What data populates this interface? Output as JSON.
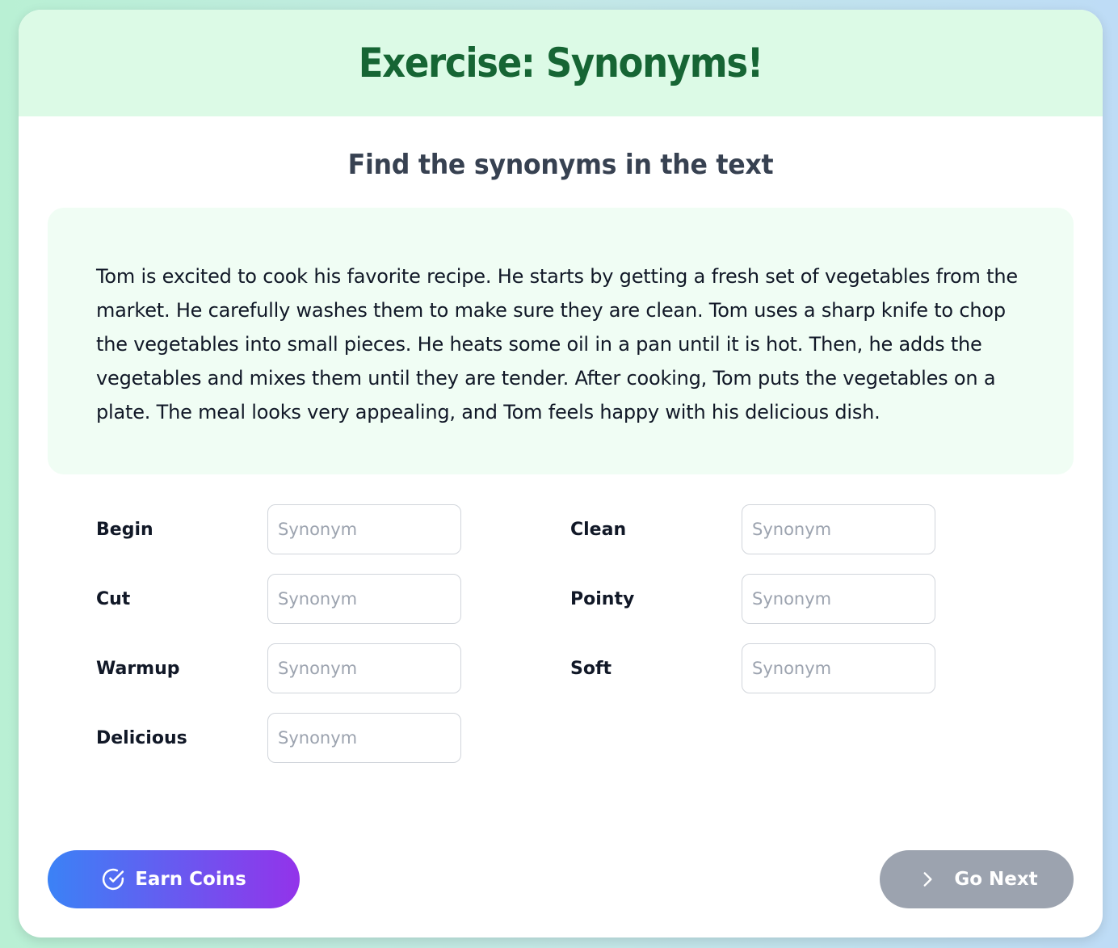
{
  "header": {
    "title": "Exercise: Synonyms!"
  },
  "instructions": "Find the synonyms in the text",
  "passage": "Tom is excited to cook his favorite recipe. He starts by getting a fresh set of vegetables from the market. He carefully washes them to make sure they are clean. Tom uses a sharp knife to chop the vegetables into small pieces. He heats some oil in a pan until it is hot. Then, he adds the vegetables and mixes them until they are tender. After cooking, Tom puts the vegetables on a plate. The meal looks very appealing, and Tom feels happy with his delicious dish.",
  "fields": [
    {
      "label": "Begin",
      "value": "",
      "placeholder": "Synonym"
    },
    {
      "label": "Clean",
      "value": "",
      "placeholder": "Synonym"
    },
    {
      "label": "Cut",
      "value": "",
      "placeholder": "Synonym"
    },
    {
      "label": "Pointy",
      "value": "",
      "placeholder": "Synonym"
    },
    {
      "label": "Warmup",
      "value": "",
      "placeholder": "Synonym"
    },
    {
      "label": "Soft",
      "value": "",
      "placeholder": "Synonym"
    },
    {
      "label": "Delicious",
      "value": "",
      "placeholder": "Synonym"
    }
  ],
  "buttons": {
    "earn_coins": {
      "label": "Earn Coins",
      "icon": "check-circle-icon"
    },
    "go_next": {
      "label": "Go Next",
      "icon": "chevron-right-icon"
    }
  },
  "colors": {
    "header_bg": "#dcfae6",
    "title": "#166534",
    "passage_bg": "#f0fdf4",
    "earn_gradient_start": "#3b82f6",
    "earn_gradient_end": "#9333ea",
    "next_disabled": "#9ca3af"
  }
}
